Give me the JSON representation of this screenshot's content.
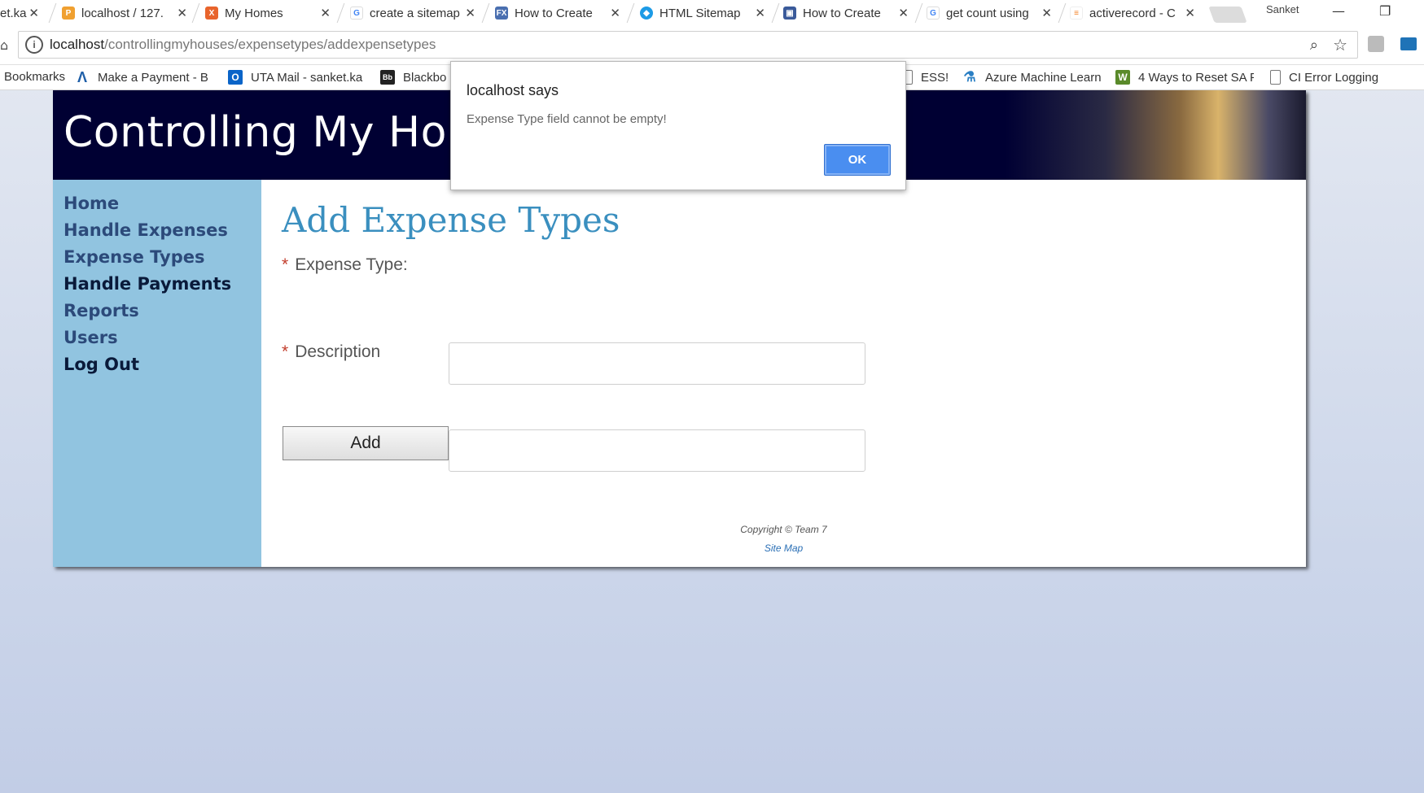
{
  "browser": {
    "tabs": [
      {
        "title": "et.ka",
        "icon": "outlook-icon",
        "close": "✕"
      },
      {
        "title": "localhost / 127.",
        "icon": "phpmyadmin-icon",
        "close": "✕"
      },
      {
        "title": "My Homes",
        "icon": "xampp-icon",
        "close": "✕"
      },
      {
        "title": "create a sitemap",
        "icon": "google-icon",
        "close": "✕"
      },
      {
        "title": "How to Create",
        "icon": "fx-icon",
        "close": "✕"
      },
      {
        "title": "HTML Sitemap",
        "icon": "sitemap-icon",
        "close": "✕"
      },
      {
        "title": "How to Create",
        "icon": "page-icon",
        "close": "✕"
      },
      {
        "title": "get count using",
        "icon": "google-icon",
        "close": "✕"
      },
      {
        "title": "activerecord - C",
        "icon": "stackoverflow-icon",
        "close": "✕"
      }
    ],
    "profile_name": "Sanket",
    "url_host": "localhost",
    "url_path": "/controllingmyhouses/expensetypes/addexpensetypes",
    "bookmarks": [
      {
        "label": "Bookmarks"
      },
      {
        "label": "Make a Payment - B"
      },
      {
        "label": "UTA Mail - sanket.ka"
      },
      {
        "label": "Blackbo"
      },
      {
        "label": "ESS!"
      },
      {
        "label": "Azure Machine Learn"
      },
      {
        "label": "4 Ways to Reset SA P"
      },
      {
        "label": "CI Error Logging"
      }
    ]
  },
  "site": {
    "title": "Controlling My Homes",
    "nav": [
      {
        "label": "Home"
      },
      {
        "label": "Handle Expenses"
      },
      {
        "label": "Expense Types"
      },
      {
        "label": "Handle Payments"
      },
      {
        "label": "Reports"
      },
      {
        "label": "Users"
      },
      {
        "label": "Log Out"
      }
    ],
    "page_title": "Add Expense Types",
    "form": {
      "required_mark": "*",
      "expense_type_label": "Expense Type:",
      "expense_type_value": "",
      "description_label": "Description",
      "description_value": "",
      "submit_label": "Add"
    },
    "footer": {
      "copyright": "Copyright © Team 7",
      "sitemap_link": "Site Map"
    }
  },
  "dialog": {
    "title": "localhost says",
    "message": "Expense Type field cannot be empty!",
    "ok_label": "OK"
  },
  "colors": {
    "header_bg": "#000033",
    "sidebar_bg": "#91c4e0",
    "title_color": "#3a8fbf",
    "ok_button": "#4a8ef0",
    "required": "#c23d2c"
  }
}
